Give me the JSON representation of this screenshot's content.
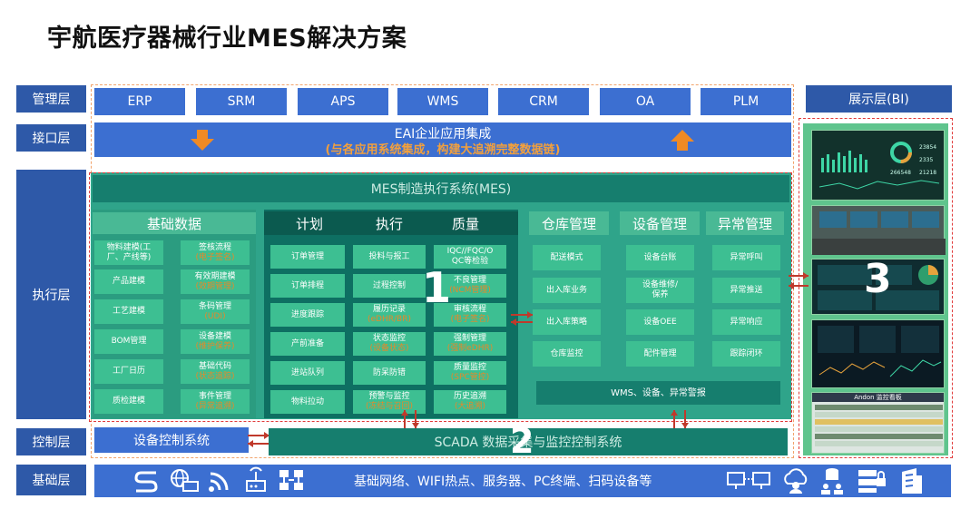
{
  "title": "宇航医疗器械行业MES解决方案",
  "layers": {
    "management": "管理层",
    "interface": "接口层",
    "execution": "执行层",
    "control": "控制层",
    "foundation": "基础层"
  },
  "management_systems": [
    "ERP",
    "SRM",
    "APS",
    "WMS",
    "CRM",
    "OA",
    "PLM"
  ],
  "display_layer": "展示层(BI)",
  "eai": {
    "title": "EAI企业应用集成",
    "subtitle": "(与各应用系统集成，构建大追溯完整数据链)"
  },
  "mes": {
    "title": "MES制造执行系统(MES)",
    "basic": {
      "header": "基础数据",
      "left": [
        {
          "main": "物料建模(工",
          "sub2": "厂、产线等)"
        },
        {
          "main": "产品建模"
        },
        {
          "main": "工艺建模"
        },
        {
          "main": "BOM管理"
        },
        {
          "main": "工厂日历"
        },
        {
          "main": "质检建模"
        }
      ],
      "right": [
        {
          "main": "签核流程",
          "sub": "(电子签名)"
        },
        {
          "main": "有效期建模",
          "sub": "(效期管理)"
        },
        {
          "main": "条码管理",
          "sub": "(UDI)"
        },
        {
          "main": "设备建模",
          "sub": "(维护保养)"
        },
        {
          "main": "基础代码",
          "sub": "(状态追踪)"
        },
        {
          "main": "事件管理",
          "sub": "(异常追溯)"
        }
      ]
    },
    "pq": {
      "headers": [
        "计划",
        "执行",
        "质量"
      ],
      "plan": [
        "订单管理",
        "订单排程",
        "进度跟踪",
        "产前准备",
        "进站队列",
        "物料拉动"
      ],
      "exec": [
        {
          "main": "投料与报工"
        },
        {
          "main": "过程控制"
        },
        {
          "main": "履历记录",
          "sub": "(eDHR/BR)"
        },
        {
          "main": "状态监控",
          "sub": "(设备状态)"
        },
        {
          "main": "防呆防错"
        },
        {
          "main": "预警与监控",
          "sub": "(冻结与召回)"
        }
      ],
      "quality": [
        {
          "main": "IQC//FQC/O",
          "main2": "QC等检验"
        },
        {
          "main": "不良管理",
          "sub": "(NCM管理)"
        },
        {
          "main": "审核流程",
          "sub": "(电子签名)"
        },
        {
          "main": "强制管理",
          "sub": "(强制eDHR)"
        },
        {
          "main": "质量监控",
          "sub": "(SPC管控)"
        },
        {
          "main": "历史追溯",
          "sub": "(大追溯)"
        }
      ]
    },
    "warehouse": {
      "header": "仓库管理",
      "items": [
        "配送模式",
        "出入库业务",
        "出入库策略",
        "仓库监控"
      ]
    },
    "equipment": {
      "header": "设备管理",
      "items": [
        "设备台账",
        "设备维修/",
        "保养",
        "设备OEE",
        "配件管理"
      ]
    },
    "exception": {
      "header": "异常管理",
      "items": [
        "异常呼叫",
        "异常推送",
        "异常响应",
        "跟踪闭环"
      ]
    },
    "alarm": "WMS、设备、异常警报"
  },
  "control": {
    "device": "设备控制系统",
    "scada": "SCADA 数据采集与监控控制系统"
  },
  "foundation_text": "基础网络、WIFI热点、服务器、PC终端、扫码设备等",
  "numbers": [
    "1",
    "2",
    "3"
  ],
  "colors": {
    "layer_label": "#2E59A8",
    "blue": "#3C6FD1",
    "mes_bg": "#2FA48A",
    "dark_teal": "#167E6E",
    "pq_bg": "#0E6F62",
    "cell_green": "#3DBF92",
    "red_dash": "#E13B3B",
    "orange": "#E6882A"
  },
  "screens": {
    "s1": {
      "nums": [
        "23854",
        "2335",
        "266548",
        "21218"
      ]
    },
    "andon": "Andon 监控看板"
  }
}
